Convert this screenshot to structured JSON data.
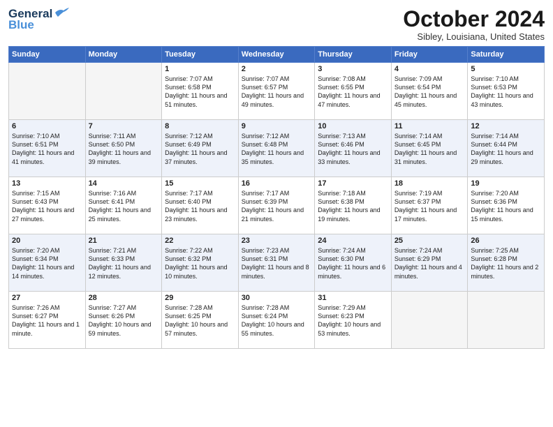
{
  "header": {
    "logo": {
      "general": "General",
      "blue": "Blue"
    },
    "title": "October 2024",
    "subtitle": "Sibley, Louisiana, United States"
  },
  "weekdays": [
    "Sunday",
    "Monday",
    "Tuesday",
    "Wednesday",
    "Thursday",
    "Friday",
    "Saturday"
  ],
  "weeks": [
    [
      {
        "day": "",
        "sunrise": "",
        "sunset": "",
        "daylight": "",
        "empty": true
      },
      {
        "day": "",
        "sunrise": "",
        "sunset": "",
        "daylight": "",
        "empty": true
      },
      {
        "day": "1",
        "sunrise": "Sunrise: 7:07 AM",
        "sunset": "Sunset: 6:58 PM",
        "daylight": "Daylight: 11 hours and 51 minutes.",
        "empty": false
      },
      {
        "day": "2",
        "sunrise": "Sunrise: 7:07 AM",
        "sunset": "Sunset: 6:57 PM",
        "daylight": "Daylight: 11 hours and 49 minutes.",
        "empty": false
      },
      {
        "day": "3",
        "sunrise": "Sunrise: 7:08 AM",
        "sunset": "Sunset: 6:55 PM",
        "daylight": "Daylight: 11 hours and 47 minutes.",
        "empty": false
      },
      {
        "day": "4",
        "sunrise": "Sunrise: 7:09 AM",
        "sunset": "Sunset: 6:54 PM",
        "daylight": "Daylight: 11 hours and 45 minutes.",
        "empty": false
      },
      {
        "day": "5",
        "sunrise": "Sunrise: 7:10 AM",
        "sunset": "Sunset: 6:53 PM",
        "daylight": "Daylight: 11 hours and 43 minutes.",
        "empty": false
      }
    ],
    [
      {
        "day": "6",
        "sunrise": "Sunrise: 7:10 AM",
        "sunset": "Sunset: 6:51 PM",
        "daylight": "Daylight: 11 hours and 41 minutes.",
        "empty": false
      },
      {
        "day": "7",
        "sunrise": "Sunrise: 7:11 AM",
        "sunset": "Sunset: 6:50 PM",
        "daylight": "Daylight: 11 hours and 39 minutes.",
        "empty": false
      },
      {
        "day": "8",
        "sunrise": "Sunrise: 7:12 AM",
        "sunset": "Sunset: 6:49 PM",
        "daylight": "Daylight: 11 hours and 37 minutes.",
        "empty": false
      },
      {
        "day": "9",
        "sunrise": "Sunrise: 7:12 AM",
        "sunset": "Sunset: 6:48 PM",
        "daylight": "Daylight: 11 hours and 35 minutes.",
        "empty": false
      },
      {
        "day": "10",
        "sunrise": "Sunrise: 7:13 AM",
        "sunset": "Sunset: 6:46 PM",
        "daylight": "Daylight: 11 hours and 33 minutes.",
        "empty": false
      },
      {
        "day": "11",
        "sunrise": "Sunrise: 7:14 AM",
        "sunset": "Sunset: 6:45 PM",
        "daylight": "Daylight: 11 hours and 31 minutes.",
        "empty": false
      },
      {
        "day": "12",
        "sunrise": "Sunrise: 7:14 AM",
        "sunset": "Sunset: 6:44 PM",
        "daylight": "Daylight: 11 hours and 29 minutes.",
        "empty": false
      }
    ],
    [
      {
        "day": "13",
        "sunrise": "Sunrise: 7:15 AM",
        "sunset": "Sunset: 6:43 PM",
        "daylight": "Daylight: 11 hours and 27 minutes.",
        "empty": false
      },
      {
        "day": "14",
        "sunrise": "Sunrise: 7:16 AM",
        "sunset": "Sunset: 6:41 PM",
        "daylight": "Daylight: 11 hours and 25 minutes.",
        "empty": false
      },
      {
        "day": "15",
        "sunrise": "Sunrise: 7:17 AM",
        "sunset": "Sunset: 6:40 PM",
        "daylight": "Daylight: 11 hours and 23 minutes.",
        "empty": false
      },
      {
        "day": "16",
        "sunrise": "Sunrise: 7:17 AM",
        "sunset": "Sunset: 6:39 PM",
        "daylight": "Daylight: 11 hours and 21 minutes.",
        "empty": false
      },
      {
        "day": "17",
        "sunrise": "Sunrise: 7:18 AM",
        "sunset": "Sunset: 6:38 PM",
        "daylight": "Daylight: 11 hours and 19 minutes.",
        "empty": false
      },
      {
        "day": "18",
        "sunrise": "Sunrise: 7:19 AM",
        "sunset": "Sunset: 6:37 PM",
        "daylight": "Daylight: 11 hours and 17 minutes.",
        "empty": false
      },
      {
        "day": "19",
        "sunrise": "Sunrise: 7:20 AM",
        "sunset": "Sunset: 6:36 PM",
        "daylight": "Daylight: 11 hours and 15 minutes.",
        "empty": false
      }
    ],
    [
      {
        "day": "20",
        "sunrise": "Sunrise: 7:20 AM",
        "sunset": "Sunset: 6:34 PM",
        "daylight": "Daylight: 11 hours and 14 minutes.",
        "empty": false
      },
      {
        "day": "21",
        "sunrise": "Sunrise: 7:21 AM",
        "sunset": "Sunset: 6:33 PM",
        "daylight": "Daylight: 11 hours and 12 minutes.",
        "empty": false
      },
      {
        "day": "22",
        "sunrise": "Sunrise: 7:22 AM",
        "sunset": "Sunset: 6:32 PM",
        "daylight": "Daylight: 11 hours and 10 minutes.",
        "empty": false
      },
      {
        "day": "23",
        "sunrise": "Sunrise: 7:23 AM",
        "sunset": "Sunset: 6:31 PM",
        "daylight": "Daylight: 11 hours and 8 minutes.",
        "empty": false
      },
      {
        "day": "24",
        "sunrise": "Sunrise: 7:24 AM",
        "sunset": "Sunset: 6:30 PM",
        "daylight": "Daylight: 11 hours and 6 minutes.",
        "empty": false
      },
      {
        "day": "25",
        "sunrise": "Sunrise: 7:24 AM",
        "sunset": "Sunset: 6:29 PM",
        "daylight": "Daylight: 11 hours and 4 minutes.",
        "empty": false
      },
      {
        "day": "26",
        "sunrise": "Sunrise: 7:25 AM",
        "sunset": "Sunset: 6:28 PM",
        "daylight": "Daylight: 11 hours and 2 minutes.",
        "empty": false
      }
    ],
    [
      {
        "day": "27",
        "sunrise": "Sunrise: 7:26 AM",
        "sunset": "Sunset: 6:27 PM",
        "daylight": "Daylight: 11 hours and 1 minute.",
        "empty": false
      },
      {
        "day": "28",
        "sunrise": "Sunrise: 7:27 AM",
        "sunset": "Sunset: 6:26 PM",
        "daylight": "Daylight: 10 hours and 59 minutes.",
        "empty": false
      },
      {
        "day": "29",
        "sunrise": "Sunrise: 7:28 AM",
        "sunset": "Sunset: 6:25 PM",
        "daylight": "Daylight: 10 hours and 57 minutes.",
        "empty": false
      },
      {
        "day": "30",
        "sunrise": "Sunrise: 7:28 AM",
        "sunset": "Sunset: 6:24 PM",
        "daylight": "Daylight: 10 hours and 55 minutes.",
        "empty": false
      },
      {
        "day": "31",
        "sunrise": "Sunrise: 7:29 AM",
        "sunset": "Sunset: 6:23 PM",
        "daylight": "Daylight: 10 hours and 53 minutes.",
        "empty": false
      },
      {
        "day": "",
        "sunrise": "",
        "sunset": "",
        "daylight": "",
        "empty": true
      },
      {
        "day": "",
        "sunrise": "",
        "sunset": "",
        "daylight": "",
        "empty": true
      }
    ]
  ]
}
